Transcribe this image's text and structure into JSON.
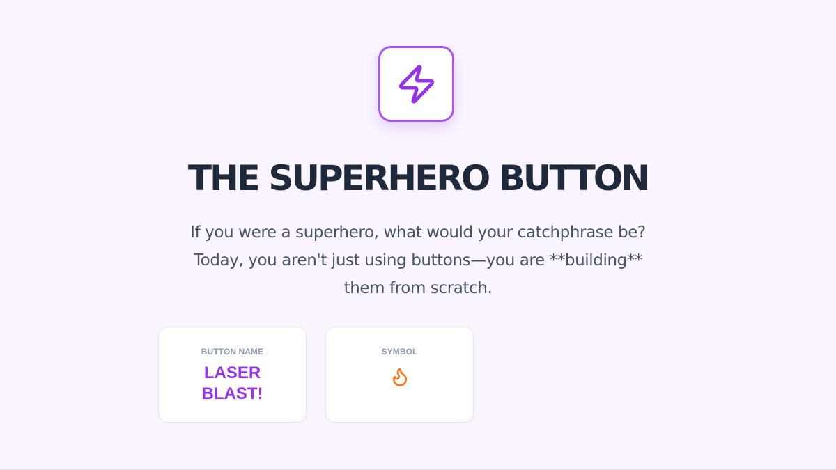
{
  "header": {
    "icon": "lightning-bolt-icon",
    "title": "THE SUPERHERO BUTTON"
  },
  "intro": {
    "line1": "If you were a superhero, what would your catchphrase be?",
    "line2": "Today, you aren't just using buttons—you are **building**",
    "line3": "them from scratch."
  },
  "cards": {
    "button_name": {
      "label": "BUTTON NAME",
      "value_line1": "LASER",
      "value_line2": "BLAST!"
    },
    "symbol": {
      "label": "SYMBOL",
      "icon": "flame-icon"
    }
  },
  "colors": {
    "background": "#faf5ff",
    "accent": "#9333ea",
    "icon_border": "#a855f7",
    "title": "#1e293b",
    "body_text": "#475569",
    "card_label": "#8f9bb0",
    "flame": "#f97316"
  }
}
